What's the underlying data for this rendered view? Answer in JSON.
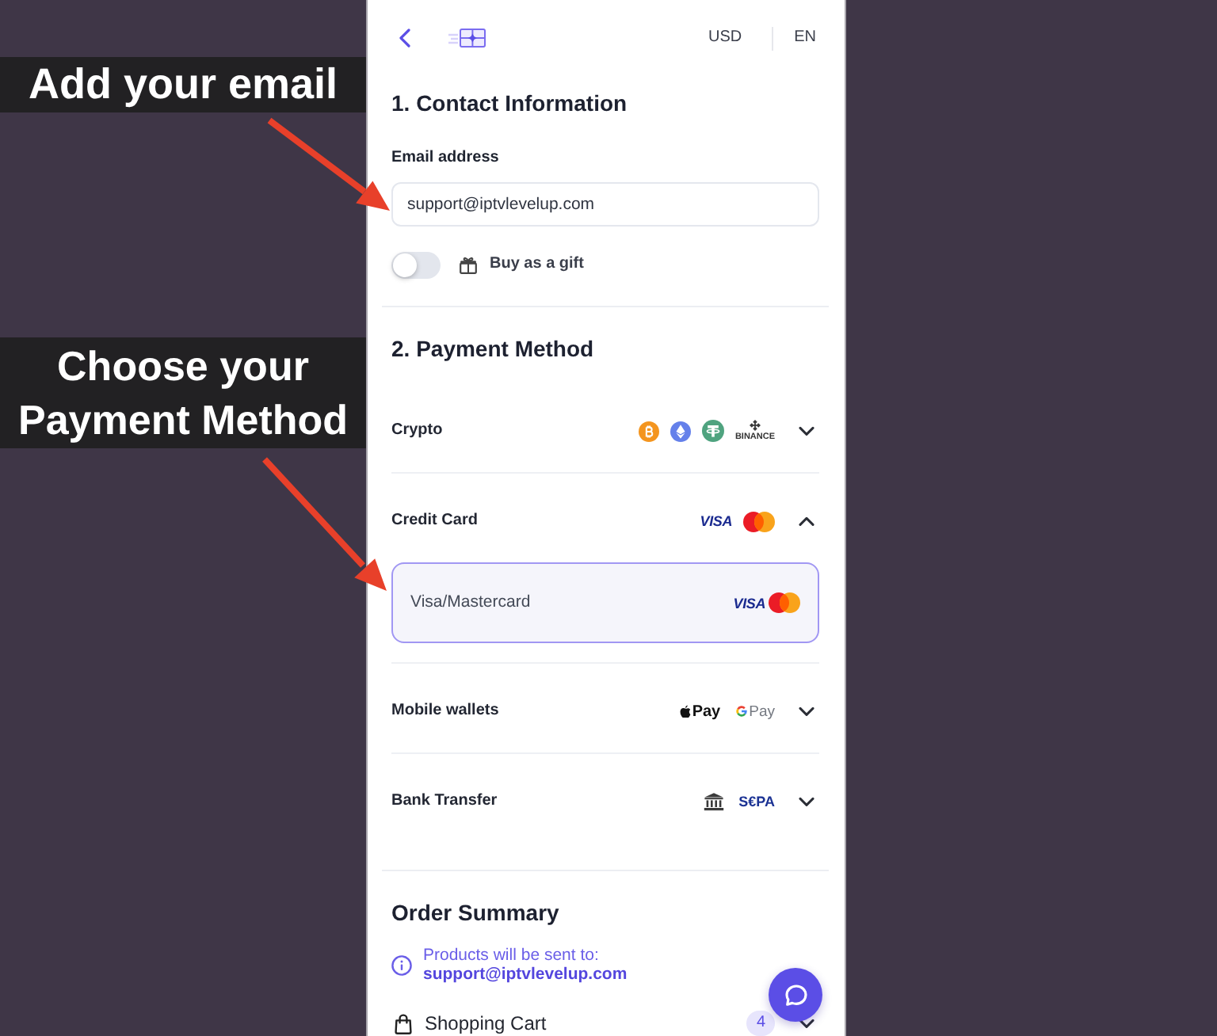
{
  "annotations": [
    {
      "text": "Add your email"
    },
    {
      "text": "Choose your Payment Method"
    }
  ],
  "header": {
    "currency": "USD",
    "language": "EN"
  },
  "contact": {
    "title": "1. Contact Information",
    "email_label": "Email address",
    "email_value": "support@iptvlevelup.com",
    "gift_toggle": {
      "label": "Buy as a gift",
      "on": false
    }
  },
  "payment": {
    "title": "2. Payment Method",
    "methods": [
      {
        "name": "Crypto",
        "expanded": false,
        "logos": [
          {
            "kind": "bitcoin"
          },
          {
            "kind": "ethereum"
          },
          {
            "kind": "tether"
          },
          {
            "kind": "binance",
            "text": "BINANCE"
          }
        ]
      },
      {
        "name": "Credit Card",
        "expanded": true,
        "logos": [
          {
            "kind": "visa",
            "text": "VISA"
          },
          {
            "kind": "mastercard"
          }
        ],
        "options": [
          {
            "name": "Visa/Mastercard",
            "selected": true,
            "logos": [
              {
                "kind": "visa",
                "text": "VISA"
              },
              {
                "kind": "mastercard"
              }
            ]
          }
        ]
      },
      {
        "name": "Mobile wallets",
        "expanded": false,
        "logos": [
          {
            "kind": "apple_pay",
            "text": "Pay"
          },
          {
            "kind": "google_pay",
            "text": "Pay"
          }
        ]
      },
      {
        "name": "Bank Transfer",
        "expanded": false,
        "logos": [
          {
            "kind": "bank"
          },
          {
            "kind": "sepa",
            "text": "S€PA"
          }
        ]
      }
    ]
  },
  "order_summary": {
    "title": "Order Summary",
    "notice": "Products will be sent to:",
    "notice_email": "support@iptvlevelup.com",
    "cart": {
      "label": "Shopping Cart",
      "count": "4",
      "expanded": false
    }
  }
}
